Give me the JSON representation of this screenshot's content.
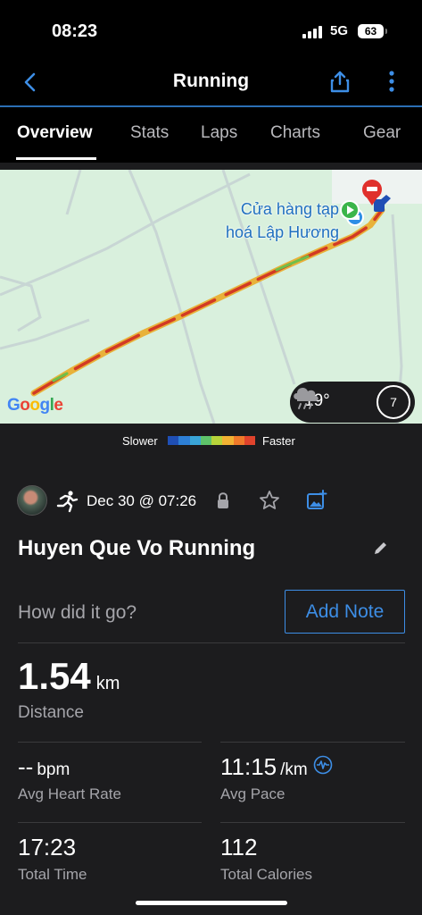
{
  "status": {
    "time": "08:23",
    "network": "5G",
    "battery": "63"
  },
  "nav": {
    "title": "Running",
    "back_icon": "chevron-left-icon",
    "share_icon": "share-icon",
    "more_icon": "more-vertical-icon"
  },
  "tabs": [
    {
      "label": "Overview",
      "active": true
    },
    {
      "label": "Stats",
      "active": false
    },
    {
      "label": "Laps",
      "active": false
    },
    {
      "label": "Charts",
      "active": false
    },
    {
      "label": "Gear",
      "active": false
    }
  ],
  "map": {
    "place_label_line1": "Cửa hàng tạp",
    "place_label_line2": "hoá Lập Hương",
    "attribution": "Google",
    "temperature": "19°",
    "wind_speed": "7",
    "background_color": "#d9f0dd"
  },
  "legend": {
    "slower": "Slower",
    "faster": "Faster",
    "scale_colors": [
      "#1f4fb5",
      "#2d7fd6",
      "#3aa5d8",
      "#5ec36a",
      "#b7d43a",
      "#f2b233",
      "#f07a2a",
      "#e0432c"
    ]
  },
  "activity": {
    "date": "Dec 30 @ 07:26",
    "title": "Huyen Que Vo Running",
    "prompt": "How did it go?",
    "add_note": "Add Note"
  },
  "stats": {
    "distance": {
      "value": "1.54",
      "unit": "km",
      "label": "Distance"
    },
    "heart_rate": {
      "value": "--",
      "unit": "bpm",
      "label": "Avg Heart Rate"
    },
    "pace": {
      "value": "11:15",
      "unit": "/km",
      "label": "Avg Pace"
    },
    "total_time": {
      "value": "17:23",
      "label": "Total Time"
    },
    "calories": {
      "value": "112",
      "label": "Total Calories"
    }
  },
  "colors": {
    "accent": "#3d8ee6",
    "divider": "#2b6fb5",
    "background": "#1c1c1e"
  }
}
